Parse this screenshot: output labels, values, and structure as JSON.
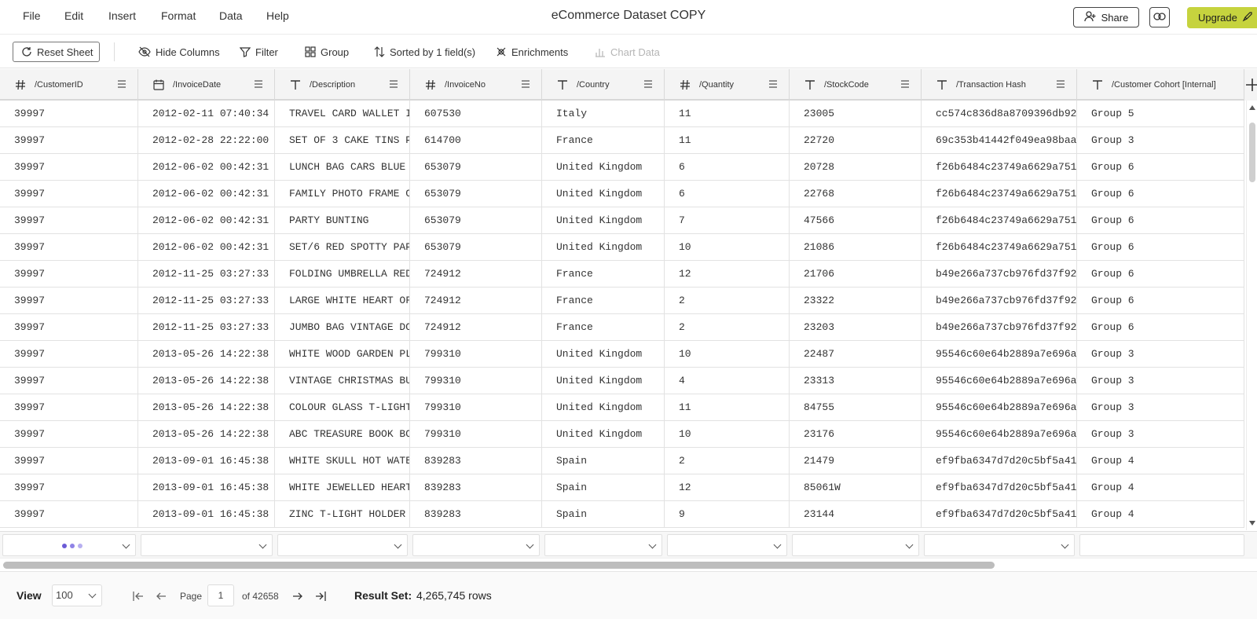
{
  "menubar": {
    "items": [
      "File",
      "Edit",
      "Insert",
      "Format",
      "Data",
      "Help"
    ],
    "title": "eCommerce Dataset COPY",
    "share_label": "Share",
    "link_icon": "link-icon",
    "upgrade_label": "Upgrade",
    "upgrade_color": "#c6d33e"
  },
  "toolbar": {
    "reset": "Reset Sheet",
    "hide": "Hide Columns",
    "filter": "Filter",
    "group": "Group",
    "sorted": "Sorted by 1 field(s)",
    "enrich": "Enrichments",
    "chart": "Chart Data"
  },
  "grid": {
    "columns": [
      {
        "label": "/CustomerID",
        "type": "number"
      },
      {
        "label": "/InvoiceDate",
        "type": "date"
      },
      {
        "label": "/Description",
        "type": "text"
      },
      {
        "label": "/InvoiceNo",
        "type": "number"
      },
      {
        "label": "/Country",
        "type": "text"
      },
      {
        "label": "/Quantity",
        "type": "number"
      },
      {
        "label": "/StockCode",
        "type": "text"
      },
      {
        "label": "/Transaction Hash",
        "type": "text"
      },
      {
        "label": "/Customer Cohort [Internal]",
        "type": "text"
      }
    ],
    "rows": [
      [
        "39997",
        "2012-02-11 07:40:34",
        "TRAVEL CARD WALLET I",
        "607530",
        "Italy",
        "11",
        "23005",
        "cc574c836d8a8709396db92",
        "Group 5"
      ],
      [
        "39997",
        "2012-02-28 22:22:00",
        "SET OF 3 CAKE TINS P",
        "614700",
        "France",
        "11",
        "22720",
        "69c353b41442f049ea98baa",
        "Group 3"
      ],
      [
        "39997",
        "2012-06-02 00:42:31",
        "LUNCH BAG CARS BLUE",
        "653079",
        "United Kingdom",
        "6",
        "20728",
        "f26b6484c23749a6629a751",
        "Group 6"
      ],
      [
        "39997",
        "2012-06-02 00:42:31",
        "FAMILY PHOTO FRAME C",
        "653079",
        "United Kingdom",
        "6",
        "22768",
        "f26b6484c23749a6629a751",
        "Group 6"
      ],
      [
        "39997",
        "2012-06-02 00:42:31",
        "PARTY BUNTING",
        "653079",
        "United Kingdom",
        "7",
        "47566",
        "f26b6484c23749a6629a751",
        "Group 6"
      ],
      [
        "39997",
        "2012-06-02 00:42:31",
        "SET/6 RED SPOTTY PAP",
        "653079",
        "United Kingdom",
        "10",
        "21086",
        "f26b6484c23749a6629a751",
        "Group 6"
      ],
      [
        "39997",
        "2012-11-25 03:27:33",
        "FOLDING UMBRELLA RED",
        "724912",
        "France",
        "12",
        "21706",
        "b49e266a737cb976fd37f92",
        "Group 6"
      ],
      [
        "39997",
        "2012-11-25 03:27:33",
        "LARGE WHITE HEART OF",
        "724912",
        "France",
        "2",
        "23322",
        "b49e266a737cb976fd37f92",
        "Group 6"
      ],
      [
        "39997",
        "2012-11-25 03:27:33",
        "JUMBO BAG VINTAGE DO",
        "724912",
        "France",
        "2",
        "23203",
        "b49e266a737cb976fd37f92",
        "Group 6"
      ],
      [
        "39997",
        "2013-05-26 14:22:38",
        "WHITE WOOD GARDEN PL",
        "799310",
        "United Kingdom",
        "10",
        "22487",
        "95546c60e64b2889a7e696a",
        "Group 3"
      ],
      [
        "39997",
        "2013-05-26 14:22:38",
        "VINTAGE CHRISTMAS BU",
        "799310",
        "United Kingdom",
        "4",
        "23313",
        "95546c60e64b2889a7e696a",
        "Group 3"
      ],
      [
        "39997",
        "2013-05-26 14:22:38",
        "COLOUR GLASS T-LIGHT",
        "799310",
        "United Kingdom",
        "11",
        "84755",
        "95546c60e64b2889a7e696a",
        "Group 3"
      ],
      [
        "39997",
        "2013-05-26 14:22:38",
        "ABC TREASURE BOOK BO",
        "799310",
        "United Kingdom",
        "10",
        "23176",
        "95546c60e64b2889a7e696a",
        "Group 3"
      ],
      [
        "39997",
        "2013-09-01 16:45:38",
        "WHITE SKULL HOT WATE",
        "839283",
        "Spain",
        "2",
        "21479",
        "ef9fba6347d7d20c5bf5a41",
        "Group 4"
      ],
      [
        "39997",
        "2013-09-01 16:45:38",
        "WHITE JEWELLED HEART",
        "839283",
        "Spain",
        "12",
        "85061W",
        "ef9fba6347d7d20c5bf5a41",
        "Group 4"
      ],
      [
        "39997",
        "2013-09-01 16:45:38",
        "ZINC T-LIGHT HOLDER",
        "839283",
        "Spain",
        "9",
        "23144",
        "ef9fba6347d7d20c5bf5a41",
        "Group 4"
      ]
    ]
  },
  "pager": {
    "view_label": "View",
    "view_value": "100",
    "page_label": "Page",
    "page_value": "1",
    "of_label": "of 42658",
    "result_label": "Result Set:",
    "result_value": "4,265,745 rows"
  }
}
